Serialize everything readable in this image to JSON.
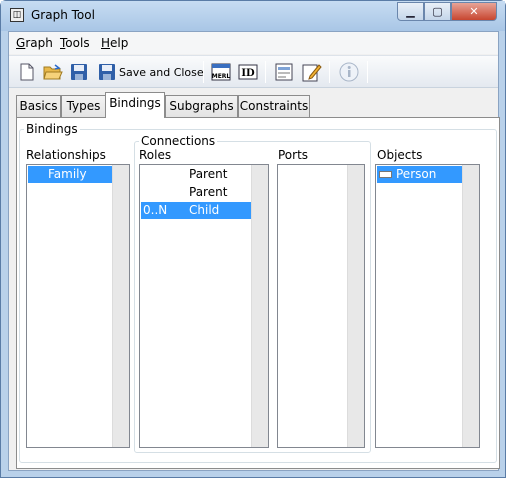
{
  "window": {
    "title": "Graph Tool",
    "min_glyph": "▁",
    "max_glyph": "▢",
    "close_glyph": "✕",
    "app_glyph": "◫"
  },
  "menubar": {
    "items": [
      "Graph",
      "Tools",
      "Help"
    ]
  },
  "toolbar": {
    "save_close_label": "Save and Close",
    "merl_label": "MERL",
    "id_label": "ID",
    "icons": [
      "new-file-icon",
      "open-folder-icon",
      "save-icon",
      "save-close-icon",
      "merl-icon",
      "id-icon",
      "form-icon",
      "edit-icon",
      "info-icon"
    ]
  },
  "tabs": [
    {
      "label": "Basics",
      "active": false
    },
    {
      "label": "Types",
      "active": false
    },
    {
      "label": "Bindings",
      "active": true
    },
    {
      "label": "Subgraphs",
      "active": false
    },
    {
      "label": "Constraints",
      "active": false
    }
  ],
  "bindings": {
    "group_title": "Bindings",
    "relationships": {
      "label": "Relationships",
      "items": [
        {
          "text": "Family",
          "selected": true
        }
      ]
    },
    "connections": {
      "group_title": "Connections",
      "roles": {
        "label": "Roles",
        "items": [
          {
            "card": "",
            "name": "Parent",
            "selected": false
          },
          {
            "card": "",
            "name": "Parent",
            "selected": false
          },
          {
            "card": "0..N",
            "name": "Child",
            "selected": true
          }
        ]
      },
      "ports": {
        "label": "Ports",
        "items": []
      }
    },
    "objects": {
      "label": "Objects",
      "items": [
        {
          "text": "Person",
          "selected": true
        }
      ]
    }
  },
  "colors": {
    "selection": "#3399ff",
    "close_button": "#c74630",
    "title_bar": "#b9d1ea"
  }
}
